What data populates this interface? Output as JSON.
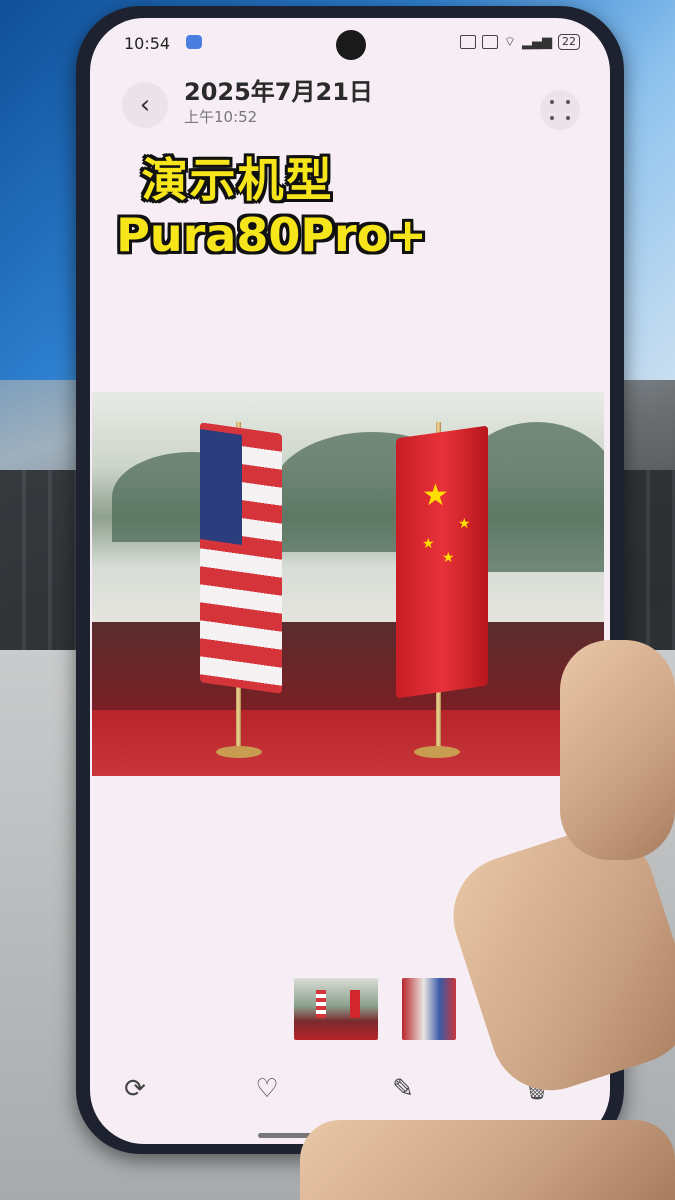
{
  "status_bar": {
    "time": "10:54",
    "battery": "22"
  },
  "header": {
    "date": "2025年7月21日",
    "time": "上午10:52",
    "back_icon": "chevron-left-icon",
    "more_icon": "more-dots-icon"
  },
  "overlay_caption": {
    "line1": "演示机型",
    "line2": "Pura80Pro+"
  },
  "photo": {
    "description_icon": "photo-image"
  },
  "bottom_bar": {
    "items": [
      {
        "icon": "share-icon",
        "glyph": "⟳"
      },
      {
        "icon": "heart-icon",
        "glyph": "♡"
      },
      {
        "icon": "edit-icon",
        "glyph": "✎"
      },
      {
        "icon": "delete-icon",
        "glyph": "🗑"
      }
    ]
  },
  "colors": {
    "caption_fill": "#f7e51c",
    "caption_stroke": "#111111",
    "screen_bg": "#f6eef4"
  }
}
